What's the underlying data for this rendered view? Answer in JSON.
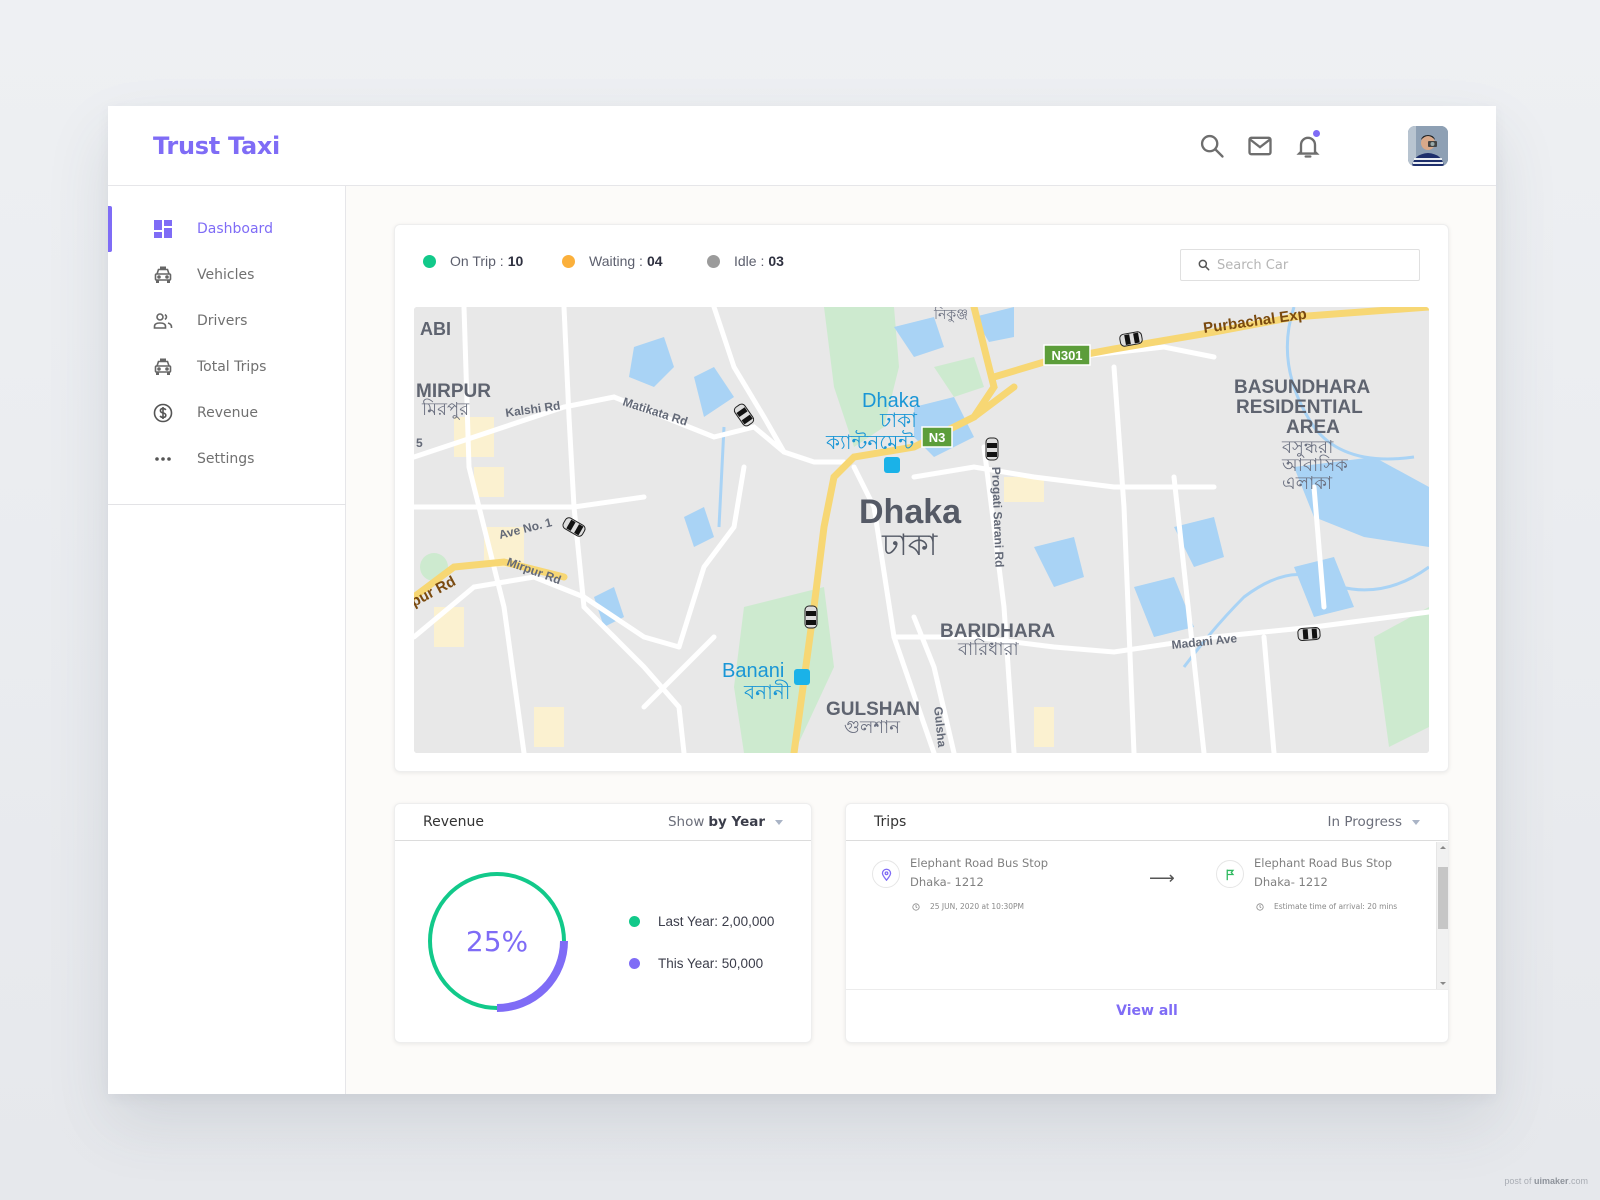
{
  "app": {
    "brand": "Trust Taxi",
    "header_icons": [
      "search-icon",
      "mail-icon",
      "bell-icon"
    ],
    "notification_dot": true,
    "accent_color": "#7f6cf6"
  },
  "sidebar": {
    "items": [
      {
        "label": "Dashboard",
        "icon": "dashboard-icon",
        "active": true
      },
      {
        "label": "Vehicles",
        "icon": "taxi-icon",
        "active": false
      },
      {
        "label": "Drivers",
        "icon": "people-icon",
        "active": false
      },
      {
        "label": "Total Trips",
        "icon": "taxi-icon",
        "active": false
      },
      {
        "label": "Revenue",
        "icon": "dollar-circle-icon",
        "active": false
      },
      {
        "label": "Settings",
        "icon": "more-dots-icon",
        "active": false
      }
    ]
  },
  "fleet_status": {
    "items": [
      {
        "label": "On Trip :",
        "value": "10",
        "color": "#12c98a"
      },
      {
        "label": "Waiting :",
        "value": "04",
        "color": "#fbb03b"
      },
      {
        "label": "Idle :",
        "value": "03",
        "color": "#9b9b9b"
      }
    ],
    "search": {
      "placeholder": "Search Car",
      "value": ""
    }
  },
  "map": {
    "labels": {
      "pallabi": "ABI",
      "mirpur": "MIRPUR",
      "mirpur_bn": "মিরপুর",
      "kalshi": "Kalshi Rd",
      "matikata": "Matikata Rd",
      "ave1": "Ave No. 1",
      "mirpur_rd": "Mirpur Rd",
      "pur_rd": "pur Rd",
      "dhaka_cant": "Dhaka",
      "dhaka_cant_bn1": "ঢাকা",
      "dhaka_cant_bn2": "ক্যান্টনমেন্ট",
      "dhaka": "Dhaka",
      "dhaka_bn": "ঢাকা",
      "n301": "N301",
      "n3": "N3",
      "purbachal": "Purbachal Exp",
      "basundhara1": "BASUNDHARA",
      "basundhara2": "RESIDENTIAL",
      "basundhara3": "AREA",
      "basundhara_bn1": "বসুন্ধরা",
      "basundhara_bn2": "আবাসিক",
      "basundhara_bn3": "এলাকা",
      "progati": "Progati Sarani Rd",
      "baridhara": "BARIDHARA",
      "baridhara_bn": "বারিধারা",
      "madani": "Madani Ave",
      "banani": "Banani",
      "banani_bn": "বনানী",
      "gulshan": "GULSHAN",
      "gulshan_bn": "গুলশান",
      "gulsha": "Gulsha",
      "ave5": "5",
      "nikunja": "নিকুঞ্জ"
    },
    "vehicle_markers": 6
  },
  "revenue": {
    "title": "Revenue",
    "filter_prefix": "Show",
    "filter_value": "by Year",
    "percent_label": "25%",
    "percent": 25,
    "legend": [
      {
        "label": "Last Year: 2,00,000",
        "color": "#12c98a"
      },
      {
        "label": "This Year: 50,000",
        "color": "#7f6cf6"
      }
    ]
  },
  "trips": {
    "title": "Trips",
    "filter_value": "In Progress",
    "rows": [
      {
        "from_name": "Elephant Road Bus Stop",
        "from_area": "Dhaka- 1212",
        "from_meta": "25 JUN, 2020 at 10:30PM",
        "to_name": "Elephant Road Bus Stop",
        "to_area": "Dhaka- 1212",
        "to_meta": "Estimate time of arrival: 20 mins"
      }
    ],
    "view_all": "View all"
  },
  "watermark": {
    "prefix": "post of ",
    "brand": "uimaker",
    "suffix": ".com"
  }
}
